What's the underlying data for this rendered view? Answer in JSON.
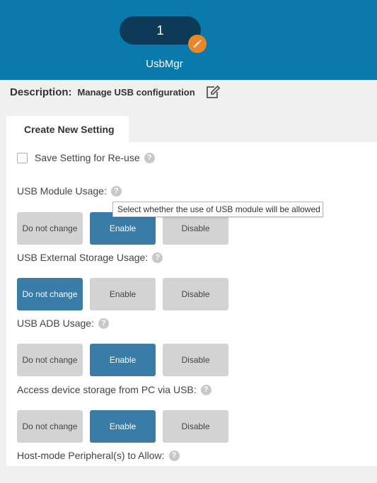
{
  "header": {
    "badge_value": "1",
    "app_name": "UsbMgr"
  },
  "description": {
    "label": "Description:",
    "value": "Manage USB configuration"
  },
  "tabs": [
    {
      "label": "Create New Setting"
    }
  ],
  "save_setting": {
    "label": "Save Setting for Re-use",
    "checked": false
  },
  "tooltip": {
    "text": "Select whether the use of USB module will be allowed"
  },
  "settings": [
    {
      "label": "USB Module Usage:",
      "options": [
        "Do not change",
        "Enable",
        "Disable"
      ],
      "selected": "Enable"
    },
    {
      "label": "USB External Storage Usage:",
      "options": [
        "Do not change",
        "Enable",
        "Disable"
      ],
      "selected": "Do not change"
    },
    {
      "label": "USB ADB Usage:",
      "options": [
        "Do not change",
        "Enable",
        "Disable"
      ],
      "selected": "Enable"
    },
    {
      "label": "Access device storage from PC via USB:",
      "options": [
        "Do not change",
        "Enable",
        "Disable"
      ],
      "selected": "Enable"
    }
  ],
  "host_mode": {
    "label": "Host-mode Peripheral(s) to Allow:"
  },
  "icons": {
    "edit": "pencil-icon",
    "description_edit": "edit-square-icon",
    "help": "help-icon"
  },
  "colors": {
    "header_bg": "#0a7aad",
    "badge_bg": "#0d3a57",
    "edit_accent": "#e9872b",
    "active_button": "#3a7ca8",
    "inactive_button": "#d3d3d3"
  }
}
